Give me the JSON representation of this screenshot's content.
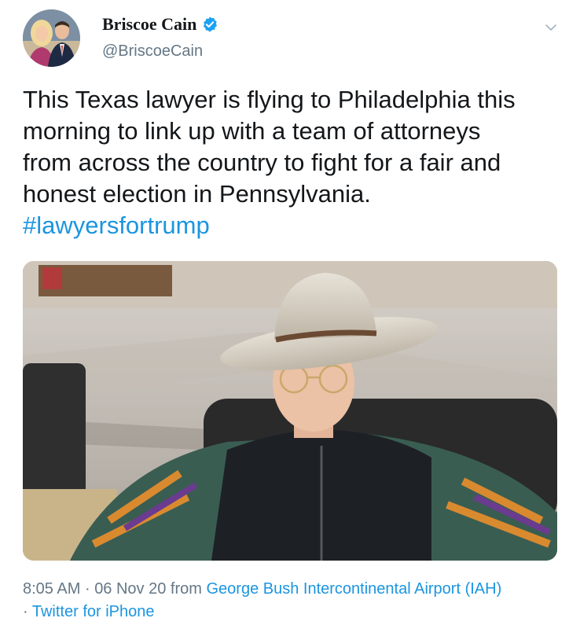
{
  "tweet": {
    "display_name": "Briscoe Cain",
    "handle": "@BriscoeCain",
    "text_lines": [
      "This Texas lawyer is flying to Philadelphia this",
      "morning to link up with a team of attorneys",
      "from across the country to fight for a fair and",
      "honest election in Pennsylvania."
    ],
    "hashtag": "#lawyersfortrump",
    "time": "8:05 AM",
    "separator": "·",
    "date": "06 Nov 20",
    "from_word": "from",
    "location": "George Bush Intercontinental Airport (IAH)",
    "source": "Twitter for iPhone"
  },
  "icons": {
    "verified": "verified-badge-icon",
    "menu": "chevron-down-icon"
  },
  "colors": {
    "link": "#1b95e0",
    "secondary_text": "#657786",
    "primary_text": "#14171a",
    "verified_badge": "#1da1f2"
  }
}
